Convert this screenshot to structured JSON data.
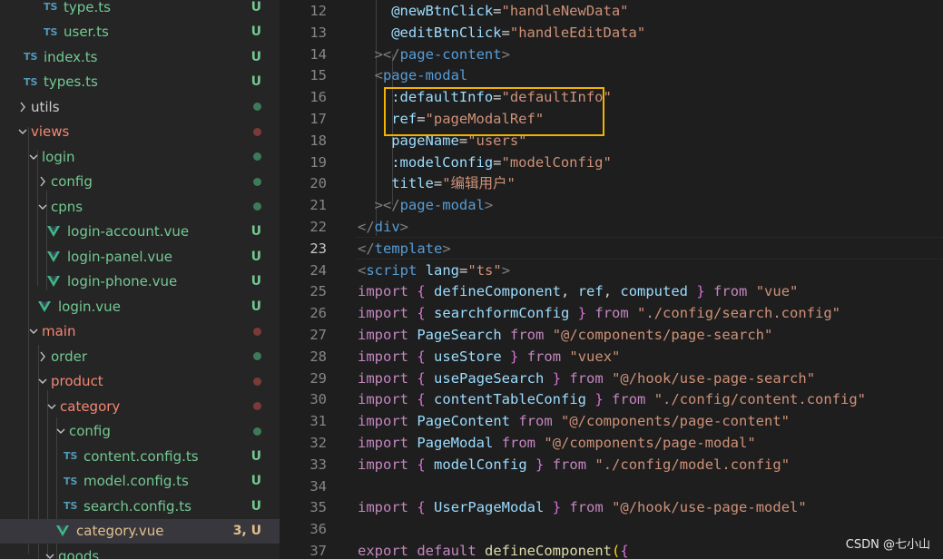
{
  "explorer": {
    "rows": [
      {
        "label": "type.ts",
        "type": "ts",
        "status": "U",
        "color": "#73c991"
      },
      {
        "label": "user.ts",
        "type": "ts",
        "status": "U",
        "color": "#73c991"
      },
      {
        "label": "index.ts",
        "type": "ts",
        "status": "U",
        "color": "#73c991"
      },
      {
        "label": "types.ts",
        "type": "ts",
        "status": "U",
        "color": "#73c991"
      },
      {
        "label": "utils",
        "type": "folder",
        "expanded": false,
        "dot": "#3d7a57",
        "color": "#cccccc"
      },
      {
        "label": "views",
        "type": "folder",
        "expanded": true,
        "dot": "#7a3a3a",
        "color": "#f48771"
      },
      {
        "label": "login",
        "type": "folder",
        "expanded": true,
        "dot": "#3d7a57",
        "color": "#73c991"
      },
      {
        "label": "config",
        "type": "folder",
        "expanded": false,
        "dot": "#3d7a57",
        "color": "#73c991"
      },
      {
        "label": "cpns",
        "type": "folder",
        "expanded": true,
        "dot": "#3d7a57",
        "color": "#73c991"
      },
      {
        "label": "login-account.vue",
        "type": "vue",
        "status": "U",
        "color": "#73c991"
      },
      {
        "label": "login-panel.vue",
        "type": "vue",
        "status": "U",
        "color": "#73c991"
      },
      {
        "label": "login-phone.vue",
        "type": "vue",
        "status": "U",
        "color": "#73c991"
      },
      {
        "label": "login.vue",
        "type": "vue",
        "status": "U",
        "color": "#73c991"
      },
      {
        "label": "main",
        "type": "folder",
        "expanded": true,
        "dot": "#7a3a3a",
        "color": "#f48771"
      },
      {
        "label": "order",
        "type": "folder",
        "expanded": false,
        "dot": "#3d7a57",
        "color": "#73c991"
      },
      {
        "label": "product",
        "type": "folder",
        "expanded": true,
        "dot": "#7a3a3a",
        "color": "#f48771"
      },
      {
        "label": "category",
        "type": "folder",
        "expanded": true,
        "dot": "#7a3a3a",
        "color": "#f48771"
      },
      {
        "label": "config",
        "type": "folder",
        "expanded": true,
        "dot": "#3d7a57",
        "color": "#73c991"
      },
      {
        "label": "content.config.ts",
        "type": "ts",
        "status": "U",
        "color": "#73c991"
      },
      {
        "label": "model.config.ts",
        "type": "ts",
        "status": "U",
        "color": "#73c991"
      },
      {
        "label": "search.config.ts",
        "type": "ts",
        "status": "U",
        "color": "#73c991"
      },
      {
        "label": "category.vue",
        "type": "vue",
        "status": "3, U",
        "color": "#e2c08d",
        "statusColor": "#e2c08d",
        "selected": true
      },
      {
        "label": "goods",
        "type": "folder",
        "expanded": true,
        "dot": "",
        "color": "#73c991"
      }
    ]
  },
  "editor": {
    "active_line": "23",
    "lines": [
      {
        "n": "12",
        "tokens": [
          [
            "    @newBtnClick",
            "attr"
          ],
          [
            "=",
            "plain"
          ],
          [
            "\"handleNewData\"",
            "str"
          ]
        ]
      },
      {
        "n": "13",
        "tokens": [
          [
            "    @editBtnClick",
            "attr"
          ],
          [
            "=",
            "plain"
          ],
          [
            "\"handleEditData\"",
            "str"
          ]
        ]
      },
      {
        "n": "14",
        "tokens": [
          [
            "  ",
            "plain"
          ],
          [
            "></",
            "punct"
          ],
          [
            "page-content",
            "tag"
          ],
          [
            ">",
            "punct"
          ]
        ]
      },
      {
        "n": "15",
        "tokens": [
          [
            "  ",
            "plain"
          ],
          [
            "<",
            "punct"
          ],
          [
            "page-modal",
            "tag"
          ]
        ]
      },
      {
        "n": "16",
        "tokens": [
          [
            "    :defaultInfo",
            "attr"
          ],
          [
            "=",
            "plain"
          ],
          [
            "\"defaultInfo\"",
            "str"
          ]
        ]
      },
      {
        "n": "17",
        "tokens": [
          [
            "    ref",
            "attr"
          ],
          [
            "=",
            "plain"
          ],
          [
            "\"pageModalRef\"",
            "str"
          ]
        ]
      },
      {
        "n": "18",
        "tokens": [
          [
            "    pageName",
            "attr"
          ],
          [
            "=",
            "plain"
          ],
          [
            "\"users\"",
            "str"
          ]
        ]
      },
      {
        "n": "19",
        "tokens": [
          [
            "    :modelConfig",
            "attr"
          ],
          [
            "=",
            "plain"
          ],
          [
            "\"modelConfig\"",
            "str"
          ]
        ]
      },
      {
        "n": "20",
        "tokens": [
          [
            "    title",
            "attr"
          ],
          [
            "=",
            "plain"
          ],
          [
            "\"编辑用户\"",
            "str"
          ]
        ]
      },
      {
        "n": "21",
        "tokens": [
          [
            "  ",
            "plain"
          ],
          [
            "></",
            "punct"
          ],
          [
            "page-modal",
            "tag"
          ],
          [
            ">",
            "punct"
          ]
        ]
      },
      {
        "n": "22",
        "tokens": [
          [
            "</",
            "punct"
          ],
          [
            "div",
            "tag"
          ],
          [
            ">",
            "punct"
          ]
        ]
      },
      {
        "n": "23",
        "tokens": [
          [
            "</",
            "punct"
          ],
          [
            "template",
            "tag"
          ],
          [
            ">",
            "punct"
          ]
        ]
      },
      {
        "n": "24",
        "tokens": [
          [
            "<",
            "punct"
          ],
          [
            "script",
            "tag"
          ],
          [
            " ",
            "plain"
          ],
          [
            "lang",
            "attr"
          ],
          [
            "=",
            "plain"
          ],
          [
            "\"ts\"",
            "str"
          ],
          [
            ">",
            "punct"
          ]
        ]
      },
      {
        "n": "25",
        "tokens": [
          [
            "import",
            "kw"
          ],
          [
            " ",
            "plain"
          ],
          [
            "{",
            "brace"
          ],
          [
            " ",
            "plain"
          ],
          [
            "defineComponent",
            "var"
          ],
          [
            ", ",
            "plain"
          ],
          [
            "ref",
            "var"
          ],
          [
            ", ",
            "plain"
          ],
          [
            "computed",
            "var"
          ],
          [
            " ",
            "plain"
          ],
          [
            "}",
            "brace"
          ],
          [
            " ",
            "plain"
          ],
          [
            "from",
            "kw"
          ],
          [
            " ",
            "plain"
          ],
          [
            "\"vue\"",
            "str"
          ]
        ]
      },
      {
        "n": "26",
        "tokens": [
          [
            "import",
            "kw"
          ],
          [
            " ",
            "plain"
          ],
          [
            "{",
            "brace"
          ],
          [
            " ",
            "plain"
          ],
          [
            "searchformConfig",
            "var"
          ],
          [
            " ",
            "plain"
          ],
          [
            "}",
            "brace"
          ],
          [
            " ",
            "plain"
          ],
          [
            "from",
            "kw"
          ],
          [
            " ",
            "plain"
          ],
          [
            "\"./config/search.config\"",
            "str"
          ]
        ]
      },
      {
        "n": "27",
        "tokens": [
          [
            "import",
            "kw"
          ],
          [
            " ",
            "plain"
          ],
          [
            "PageSearch",
            "var"
          ],
          [
            " ",
            "plain"
          ],
          [
            "from",
            "kw"
          ],
          [
            " ",
            "plain"
          ],
          [
            "\"@/components/page-search\"",
            "str"
          ]
        ]
      },
      {
        "n": "28",
        "tokens": [
          [
            "import",
            "kw"
          ],
          [
            " ",
            "plain"
          ],
          [
            "{",
            "brace"
          ],
          [
            " ",
            "plain"
          ],
          [
            "useStore",
            "var"
          ],
          [
            " ",
            "plain"
          ],
          [
            "}",
            "brace"
          ],
          [
            " ",
            "plain"
          ],
          [
            "from",
            "kw"
          ],
          [
            " ",
            "plain"
          ],
          [
            "\"vuex\"",
            "str"
          ]
        ]
      },
      {
        "n": "29",
        "tokens": [
          [
            "import",
            "kw"
          ],
          [
            " ",
            "plain"
          ],
          [
            "{",
            "brace"
          ],
          [
            " ",
            "plain"
          ],
          [
            "usePageSearch",
            "var"
          ],
          [
            " ",
            "plain"
          ],
          [
            "}",
            "brace"
          ],
          [
            " ",
            "plain"
          ],
          [
            "from",
            "kw"
          ],
          [
            " ",
            "plain"
          ],
          [
            "\"@/hook/use-page-search\"",
            "str"
          ]
        ]
      },
      {
        "n": "30",
        "tokens": [
          [
            "import",
            "kw"
          ],
          [
            " ",
            "plain"
          ],
          [
            "{",
            "brace"
          ],
          [
            " ",
            "plain"
          ],
          [
            "contentTableConfig",
            "var"
          ],
          [
            " ",
            "plain"
          ],
          [
            "}",
            "brace"
          ],
          [
            " ",
            "plain"
          ],
          [
            "from",
            "kw"
          ],
          [
            " ",
            "plain"
          ],
          [
            "\"./config/content.config\"",
            "str"
          ]
        ]
      },
      {
        "n": "31",
        "tokens": [
          [
            "import",
            "kw"
          ],
          [
            " ",
            "plain"
          ],
          [
            "PageContent",
            "var"
          ],
          [
            " ",
            "plain"
          ],
          [
            "from",
            "kw"
          ],
          [
            " ",
            "plain"
          ],
          [
            "\"@/components/page-content\"",
            "str"
          ]
        ]
      },
      {
        "n": "32",
        "tokens": [
          [
            "import",
            "kw"
          ],
          [
            " ",
            "plain"
          ],
          [
            "PageModal",
            "var"
          ],
          [
            " ",
            "plain"
          ],
          [
            "from",
            "kw"
          ],
          [
            " ",
            "plain"
          ],
          [
            "\"@/components/page-modal\"",
            "str"
          ]
        ]
      },
      {
        "n": "33",
        "tokens": [
          [
            "import",
            "kw"
          ],
          [
            " ",
            "plain"
          ],
          [
            "{",
            "brace"
          ],
          [
            " ",
            "plain"
          ],
          [
            "modelConfig",
            "var"
          ],
          [
            " ",
            "plain"
          ],
          [
            "}",
            "brace"
          ],
          [
            " ",
            "plain"
          ],
          [
            "from",
            "kw"
          ],
          [
            " ",
            "plain"
          ],
          [
            "\"./config/model.config\"",
            "str"
          ]
        ]
      },
      {
        "n": "34",
        "tokens": []
      },
      {
        "n": "35",
        "tokens": [
          [
            "import",
            "kw"
          ],
          [
            " ",
            "plain"
          ],
          [
            "{",
            "brace"
          ],
          [
            " ",
            "plain"
          ],
          [
            "UserPageModal",
            "var"
          ],
          [
            " ",
            "plain"
          ],
          [
            "}",
            "brace"
          ],
          [
            " ",
            "plain"
          ],
          [
            "from",
            "kw"
          ],
          [
            " ",
            "plain"
          ],
          [
            "\"@/hook/use-page-model\"",
            "str"
          ]
        ]
      },
      {
        "n": "36",
        "tokens": []
      },
      {
        "n": "37",
        "tokens": [
          [
            "export",
            "kw"
          ],
          [
            " ",
            "plain"
          ],
          [
            "default",
            "kw"
          ],
          [
            " ",
            "plain"
          ],
          [
            "defineComponent",
            "fn"
          ],
          [
            "(",
            "brace2"
          ],
          [
            "{",
            "brace"
          ]
        ]
      }
    ]
  },
  "watermark": "CSDN @七小山",
  "icons": {
    "ts": "TS",
    "folder_chevron": "chevron-icon",
    "vue": "vue-icon"
  }
}
